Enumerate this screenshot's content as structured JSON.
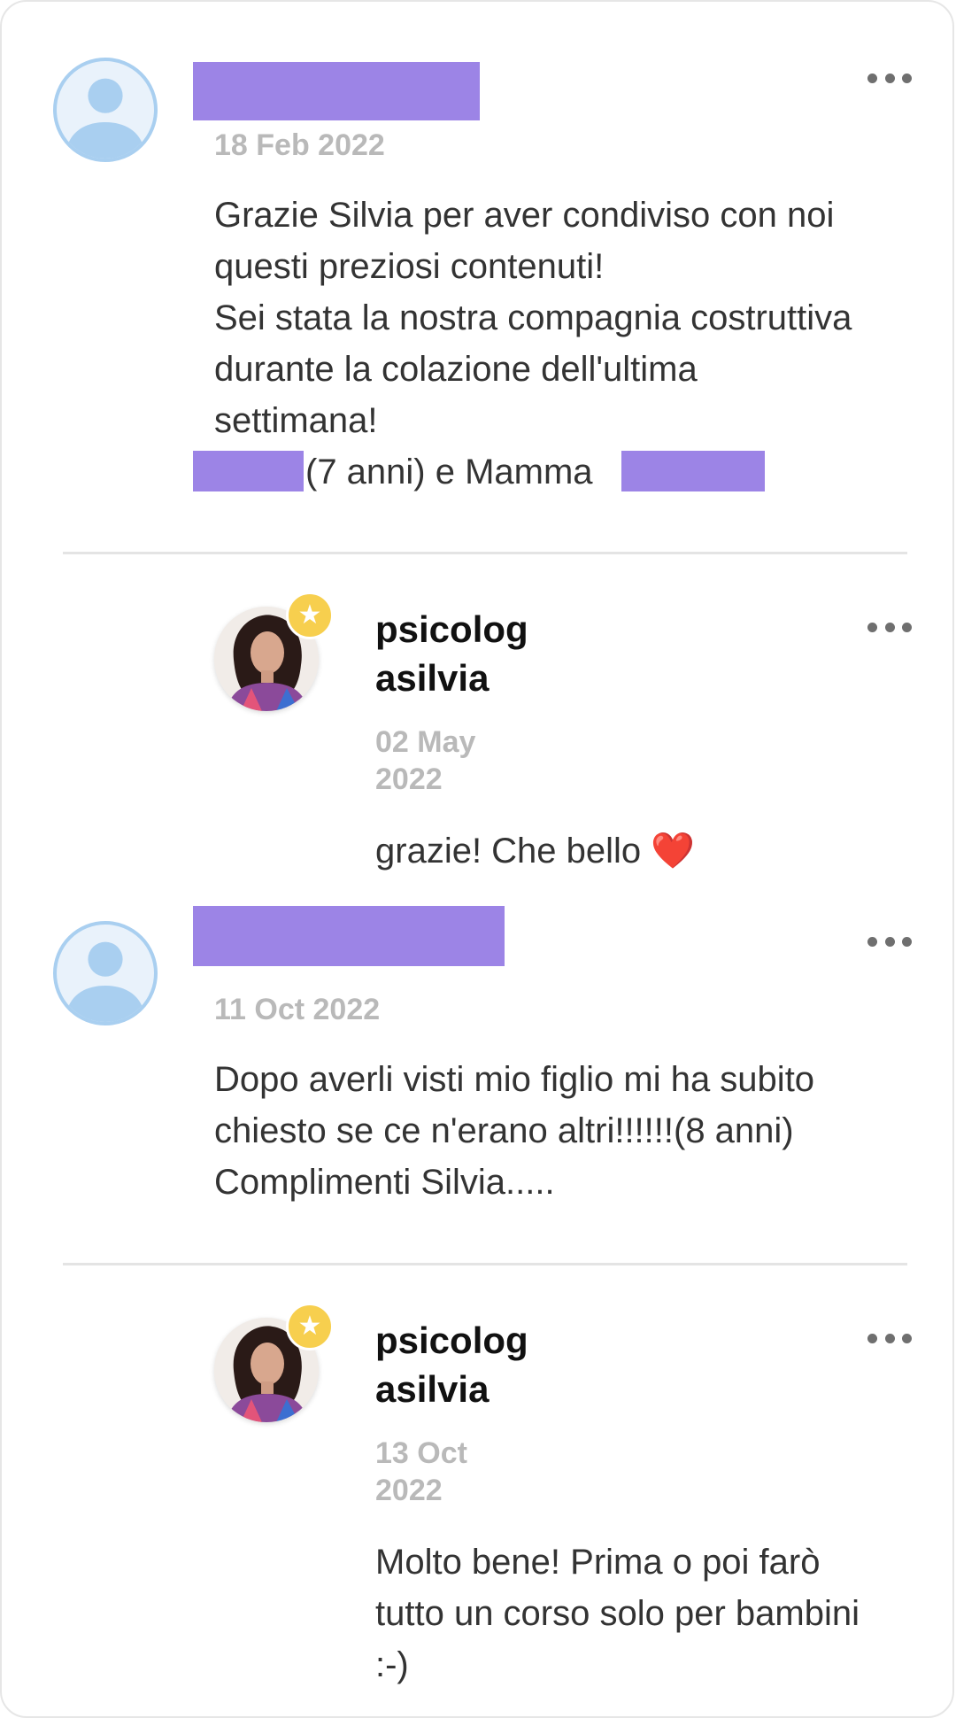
{
  "comments": [
    {
      "date": "18 Feb 2022",
      "text_lines": [
        "Grazie Silvia per aver condiviso con noi",
        "questi preziosi contenuti!",
        "Sei stata la nostra compagnia costruttiva",
        "durante la colazione dell'ultima",
        "settimana!"
      ],
      "signature_middle": "(7 anni) e Mamma",
      "reply": {
        "author_lines": [
          "psicolog",
          "asilvia"
        ],
        "date_lines": [
          "02 May",
          "2022"
        ],
        "text": "grazie! Che bello",
        "emoji": "❤️"
      }
    },
    {
      "date": "11 Oct 2022",
      "text_lines": [
        "Dopo averli visti mio figlio mi ha subito",
        "chiesto se ce n'erano altri!!!!!!(8 anni)",
        "Complimenti Silvia....."
      ],
      "reply": {
        "author_lines": [
          "psicolog",
          "asilvia"
        ],
        "date_lines": [
          "13 Oct",
          "2022"
        ],
        "text_lines": [
          "Molto bene! Prima o poi farò",
          "tutto un corso solo per bambini",
          ":-)"
        ]
      }
    }
  ],
  "icons": {
    "more": "more-horizontal-icon",
    "default_avatar": "user-silhouette-icon",
    "badge": "star-icon"
  },
  "colors": {
    "redaction": "#9c84e6",
    "badge": "#f7cf4e",
    "date": "#b9b9b9"
  }
}
